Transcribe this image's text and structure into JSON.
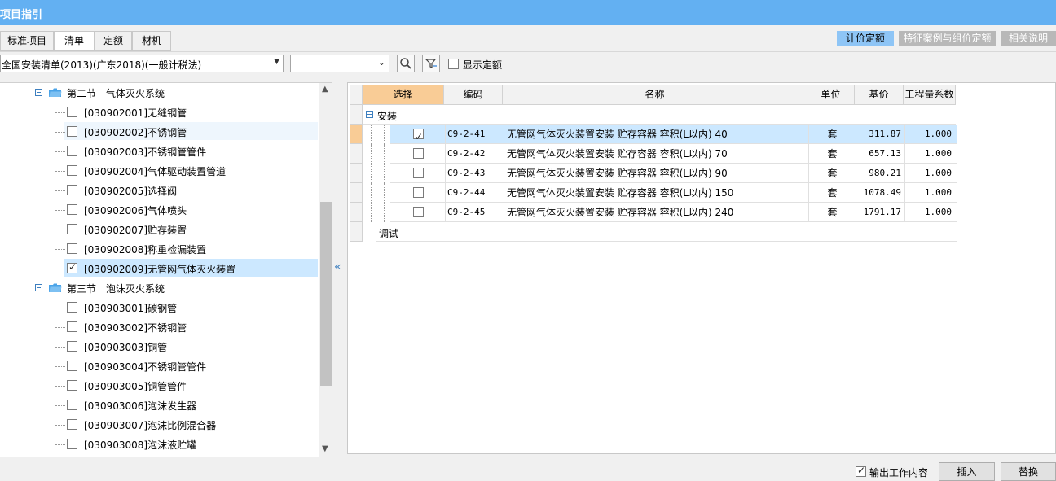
{
  "title": "项目指引",
  "tabs": [
    "标准项目",
    "清单",
    "定额",
    "材机"
  ],
  "active_tab": 1,
  "right_buttons": [
    "计价定额",
    "特征案例与组价定额",
    "相关说明"
  ],
  "library_select": {
    "value": "全国安装清单(2013)(广东2018)(一般计税法)"
  },
  "filter_select": {
    "value": ""
  },
  "show_quota": {
    "label": "显示定额",
    "checked": false
  },
  "tree": {
    "items": [
      {
        "type": "section",
        "label": "第二节　气体灭火系统"
      },
      {
        "type": "item",
        "label": "[030902001]无缝钢管",
        "checked": false
      },
      {
        "type": "item",
        "label": "[030902002]不锈钢管",
        "checked": false
      },
      {
        "type": "item",
        "label": "[030902003]不锈钢管管件",
        "checked": false
      },
      {
        "type": "item",
        "label": "[030902004]气体驱动装置管道",
        "checked": false
      },
      {
        "type": "item",
        "label": "[030902005]选择阀",
        "checked": false
      },
      {
        "type": "item",
        "label": "[030902006]气体喷头",
        "checked": false
      },
      {
        "type": "item",
        "label": "[030902007]贮存装置",
        "checked": false
      },
      {
        "type": "item",
        "label": "[030902008]称重检漏装置",
        "checked": false
      },
      {
        "type": "item",
        "label": "[030902009]无管网气体灭火装置",
        "checked": true
      },
      {
        "type": "section",
        "label": "第三节　泡沫灭火系统"
      },
      {
        "type": "item",
        "label": "[030903001]碳钢管",
        "checked": false
      },
      {
        "type": "item",
        "label": "[030903002]不锈钢管",
        "checked": false
      },
      {
        "type": "item",
        "label": "[030903003]铜管",
        "checked": false
      },
      {
        "type": "item",
        "label": "[030903004]不锈钢管管件",
        "checked": false
      },
      {
        "type": "item",
        "label": "[030903005]铜管管件",
        "checked": false
      },
      {
        "type": "item",
        "label": "[030903006]泡沫发生器",
        "checked": false
      },
      {
        "type": "item",
        "label": "[030903007]泡沫比例混合器",
        "checked": false
      },
      {
        "type": "item",
        "label": "[030903008]泡沫液贮罐",
        "checked": false
      }
    ]
  },
  "grid": {
    "columns": [
      "选择",
      "编码",
      "名称",
      "单位",
      "基价",
      "工程量系数"
    ],
    "groups": [
      {
        "label": "安装",
        "rows": [
          {
            "checked": true,
            "code": "C9-2-41",
            "name": "无管网气体灭火装置安装 贮存容器 容积(L以内) 40",
            "unit": "套",
            "price": "311.87",
            "coef": "1.000"
          },
          {
            "checked": false,
            "code": "C9-2-42",
            "name": "无管网气体灭火装置安装 贮存容器 容积(L以内) 70",
            "unit": "套",
            "price": "657.13",
            "coef": "1.000"
          },
          {
            "checked": false,
            "code": "C9-2-43",
            "name": "无管网气体灭火装置安装 贮存容器 容积(L以内) 90",
            "unit": "套",
            "price": "980.21",
            "coef": "1.000"
          },
          {
            "checked": false,
            "code": "C9-2-44",
            "name": "无管网气体灭火装置安装 贮存容器 容积(L以内) 150",
            "unit": "套",
            "price": "1078.49",
            "coef": "1.000"
          },
          {
            "checked": false,
            "code": "C9-2-45",
            "name": "无管网气体灭火装置安装 贮存容器 容积(L以内) 240",
            "unit": "套",
            "price": "1791.17",
            "coef": "1.000"
          }
        ]
      },
      {
        "label": "调试",
        "rows": []
      }
    ]
  },
  "output_work": {
    "label": "输出工作内容",
    "checked": true
  },
  "bottom_buttons": [
    "插入",
    "替换"
  ],
  "colors": {
    "titlebar": "#63b0f2",
    "selection": "#cce8ff",
    "header_selected": "#f9cc96"
  }
}
